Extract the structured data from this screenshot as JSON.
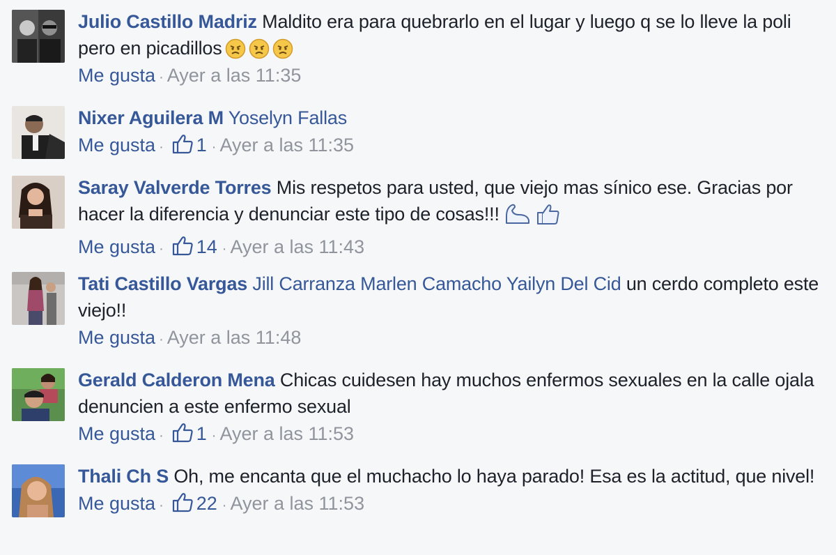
{
  "comments": [
    {
      "author": "Julio Castillo Madriz",
      "text": "Maldito era para quebrarlo en el lugar y luego q se lo lleve la poli pero en picadillos",
      "emojis": [
        "angry-face-icon",
        "angry-face-icon",
        "angry-face-icon"
      ],
      "like_label": "Me gusta",
      "time": "Ayer a las 11:35"
    },
    {
      "author": "Nixer Aguilera M",
      "mentions": "Yoselyn Fallas",
      "like_label": "Me gusta",
      "likes": "1",
      "time": "Ayer a las 11:35"
    },
    {
      "author": "Saray Valverde Torres",
      "text": "Mis respetos para usted, que viejo mas sínico ese. Gracias por hacer la diferencia y denunciar este tipo de cosas!!!",
      "emojis": [
        "flexed-arm-icon",
        "thumbs-up-icon"
      ],
      "like_label": "Me gusta",
      "likes": "14",
      "time": "Ayer a las 11:43"
    },
    {
      "author": "Tati Castillo Vargas",
      "mentions": "Jill Carranza Marlen Camacho Yailyn Del Cid",
      "text": "un cerdo completo este viejo!!",
      "like_label": "Me gusta",
      "time": "Ayer a las 11:48"
    },
    {
      "author": "Gerald Calderon Mena",
      "text": "Chicas cuidesen hay muchos enfermos sexuales en la calle ojala denuncien a este enfermo sexual",
      "like_label": "Me gusta",
      "likes": "1",
      "time": "Ayer a las 11:53"
    },
    {
      "author": "Thali Ch S",
      "text": "Oh, me encanta que el muchacho lo haya parado! Esa es la actitud, que nivel!",
      "like_label": "Me gusta",
      "likes": "22",
      "time": "Ayer a las 11:53"
    }
  ],
  "colors": {
    "link": "#365899",
    "meta": "#90949c",
    "background": "#f6f7f9",
    "text": "#1d2129"
  }
}
